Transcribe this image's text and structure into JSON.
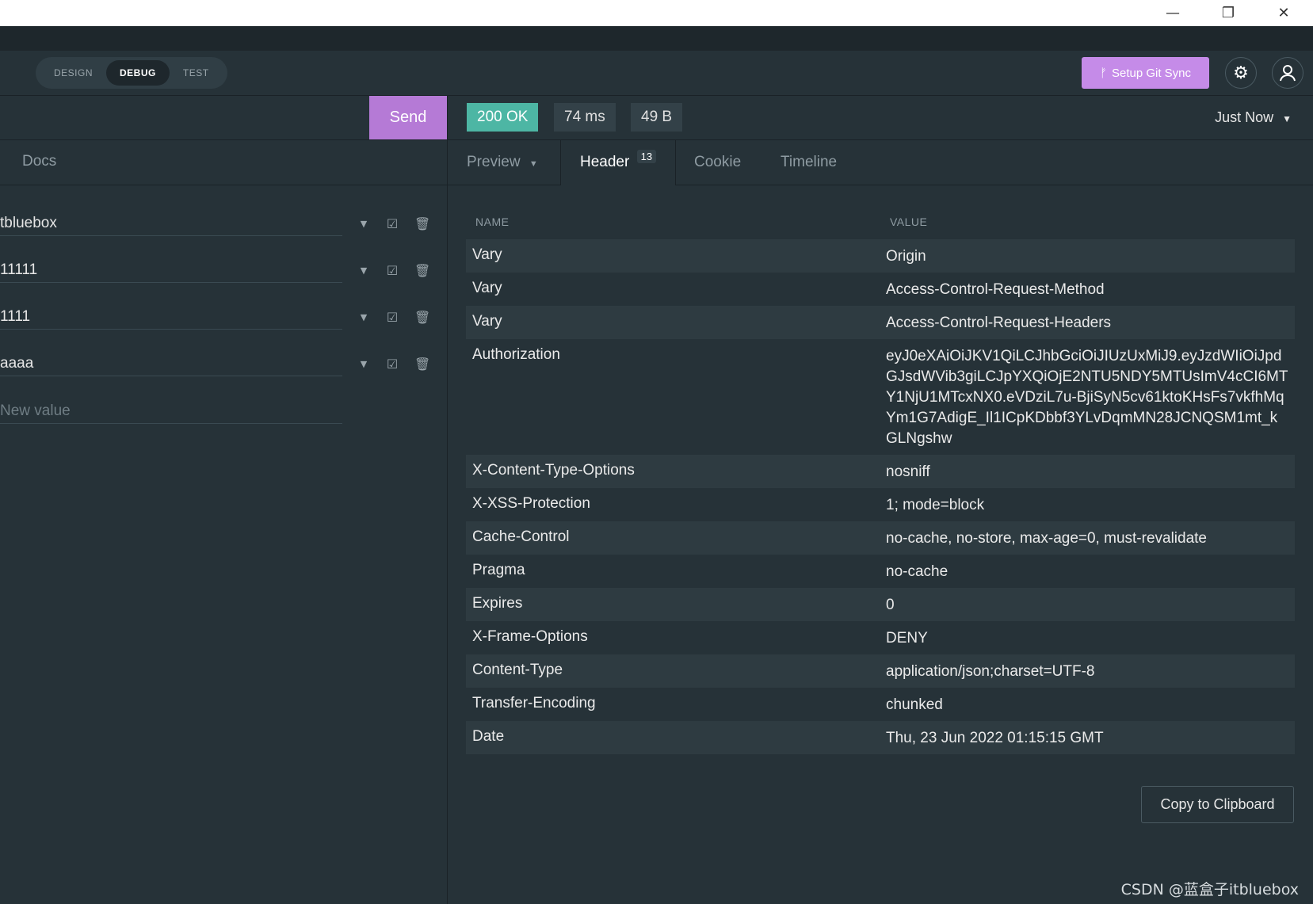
{
  "window": {
    "minimize": "—",
    "restore": "❐",
    "close": "✕"
  },
  "modes": {
    "design": "DESIGN",
    "debug": "DEBUG",
    "test": "TEST"
  },
  "header": {
    "git_sync": "Setup Git Sync",
    "git_icon": "ᚠ",
    "settings_icon": "⚙",
    "account_icon": "👤"
  },
  "request": {
    "send": "Send"
  },
  "response": {
    "status": "200 OK",
    "time": "74 ms",
    "size": "49 B",
    "history": "Just Now",
    "history_caret": "▼"
  },
  "left_tabs": {
    "docs": "Docs"
  },
  "right_tabs": {
    "preview": "Preview",
    "preview_caret": "▼",
    "header": "Header",
    "header_count": "13",
    "cookie": "Cookie",
    "timeline": "Timeline"
  },
  "query": {
    "rows": [
      "tbluebox",
      "11111",
      "1111",
      "aaaa"
    ],
    "new_placeholder": "New value",
    "caret": "▼",
    "check": "☑",
    "trash": "🗑"
  },
  "headers": {
    "col_name": "NAME",
    "col_value": "VALUE",
    "rows": [
      {
        "name": "Vary",
        "value": "Origin"
      },
      {
        "name": "Vary",
        "value": "Access-Control-Request-Method"
      },
      {
        "name": "Vary",
        "value": "Access-Control-Request-Headers"
      },
      {
        "name": "Authorization",
        "value": "eyJ0eXAiOiJKV1QiLCJhbGciOiJIUzUxMiJ9.eyJzdWIiOiJpdGJsdWVib3giLCJpYXQiOjE2NTU5NDY5MTUsImV4cCI6MTY1NjU1MTcxNX0.eVDziL7u-BjiSyN5cv61ktoKHsFs7vkfhMqYm1G7AdigE_Il1ICpKDbbf3YLvDqmMN28JCNQSM1mt_kGLNgshw"
      },
      {
        "name": "X-Content-Type-Options",
        "value": "nosniff"
      },
      {
        "name": "X-XSS-Protection",
        "value": "1; mode=block"
      },
      {
        "name": "Cache-Control",
        "value": "no-cache, no-store, max-age=0, must-revalidate"
      },
      {
        "name": "Pragma",
        "value": "no-cache"
      },
      {
        "name": "Expires",
        "value": "0"
      },
      {
        "name": "X-Frame-Options",
        "value": "DENY"
      },
      {
        "name": "Content-Type",
        "value": "application/json;charset=UTF-8"
      },
      {
        "name": "Transfer-Encoding",
        "value": "chunked"
      },
      {
        "name": "Date",
        "value": "Thu, 23 Jun 2022 01:15:15 GMT"
      }
    ]
  },
  "copy_button": "Copy to Clipboard",
  "watermark": "CSDN @蓝盒子itbluebox"
}
